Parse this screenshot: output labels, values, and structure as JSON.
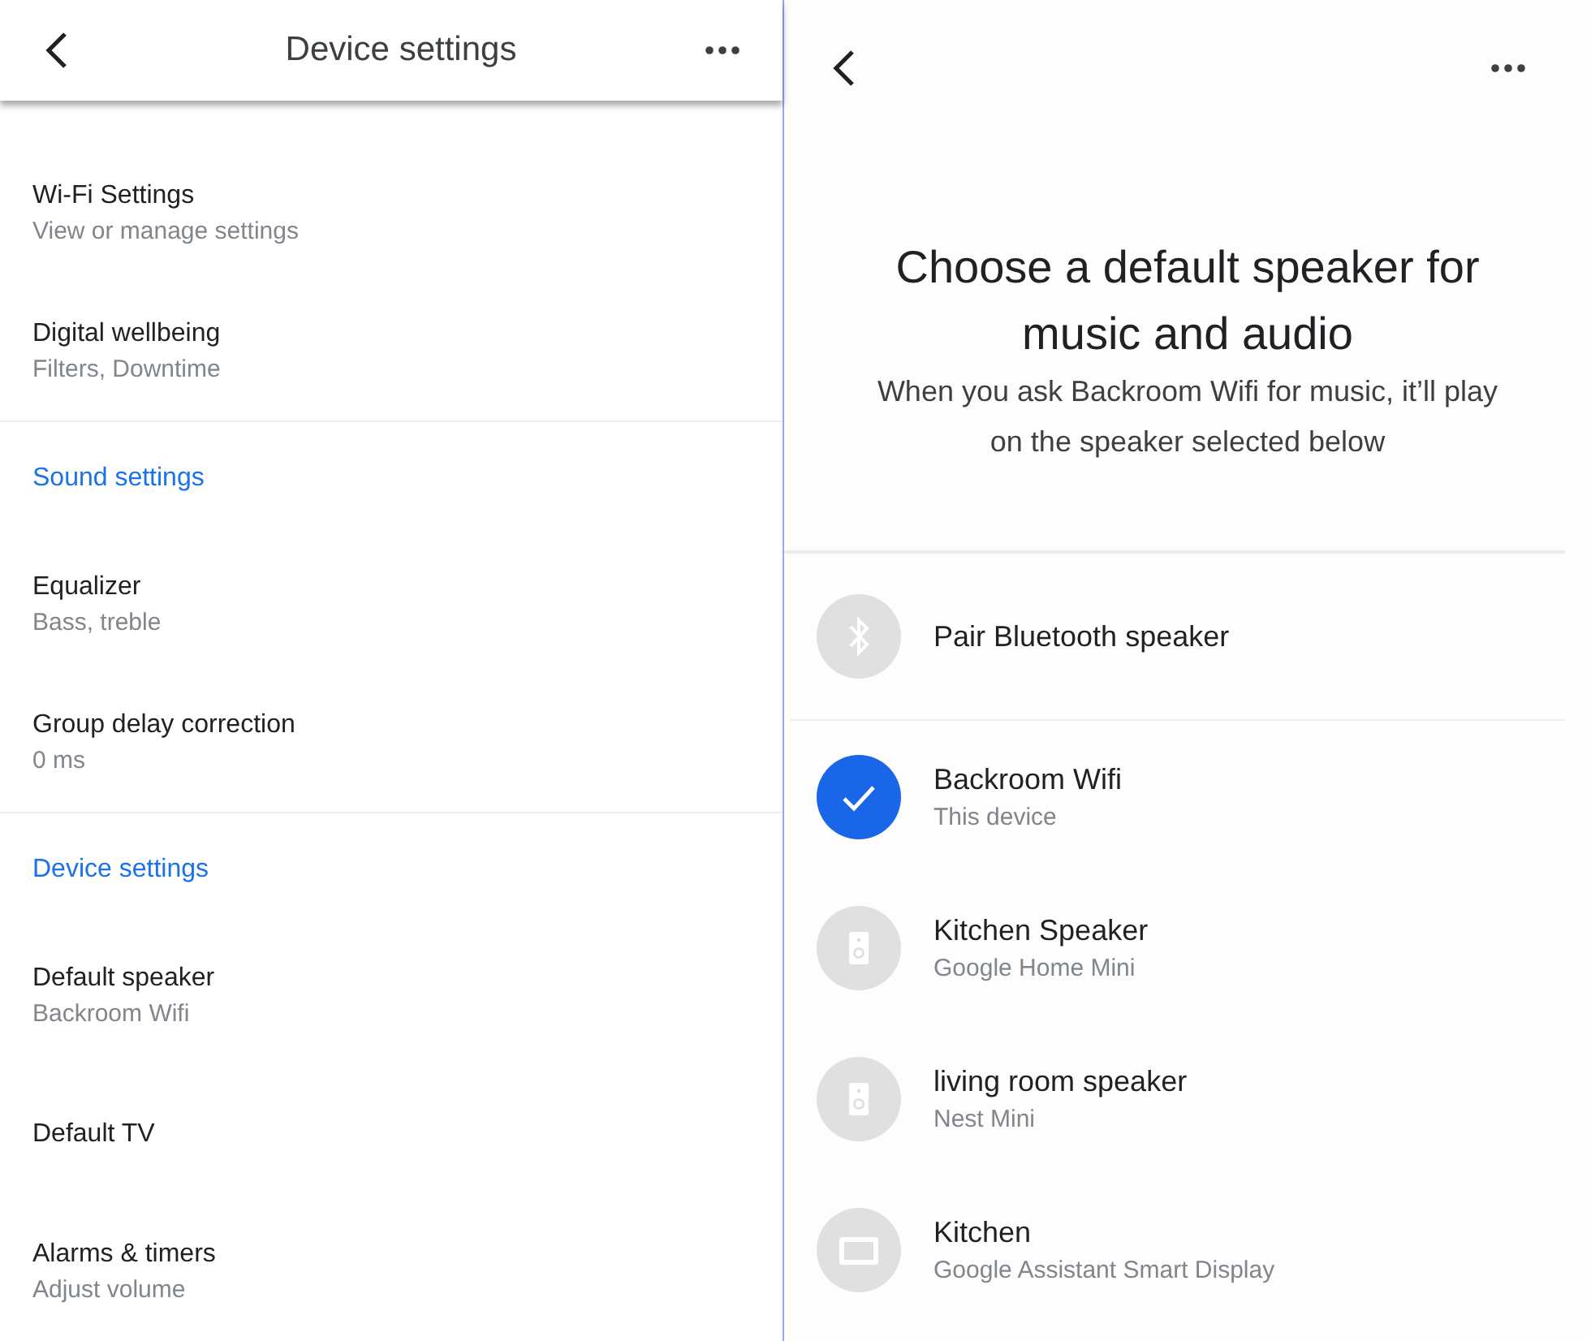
{
  "left_panel": {
    "header": {
      "title": "Device settings"
    },
    "rows": [
      {
        "kind": "item",
        "title": "Wi-Fi Settings",
        "subtitle": "View or manage settings"
      },
      {
        "kind": "item",
        "title": "Digital wellbeing",
        "subtitle": "Filters, Downtime"
      },
      {
        "kind": "section",
        "title": "Sound settings"
      },
      {
        "kind": "item",
        "title": "Equalizer",
        "subtitle": "Bass, treble"
      },
      {
        "kind": "item",
        "title": "Group delay correction",
        "subtitle": "0 ms"
      },
      {
        "kind": "section",
        "title": "Device settings"
      },
      {
        "kind": "item",
        "title": "Default speaker",
        "subtitle": "Backroom Wifi"
      },
      {
        "kind": "item",
        "title": "Default TV"
      },
      {
        "kind": "item",
        "title": "Alarms & timers",
        "subtitle": "Adjust volume"
      }
    ]
  },
  "right_panel": {
    "title": "Choose a default speaker for music and audio",
    "description": "When you ask Backroom Wifi for music, it’ll play on the speaker selected below",
    "pair_action": {
      "label": "Pair Bluetooth speaker"
    },
    "speakers": [
      {
        "kind": "speaker",
        "name": "Backroom Wifi",
        "subtitle": "This device",
        "selected": true
      },
      {
        "kind": "speaker",
        "name": "Kitchen Speaker",
        "subtitle": "Google Home Mini",
        "selected": false
      },
      {
        "kind": "speaker",
        "name": "living room speaker",
        "subtitle": "Nest Mini",
        "selected": false
      },
      {
        "kind": "display",
        "name": "Kitchen",
        "subtitle": "Google Assistant Smart Display",
        "selected": false
      }
    ]
  }
}
